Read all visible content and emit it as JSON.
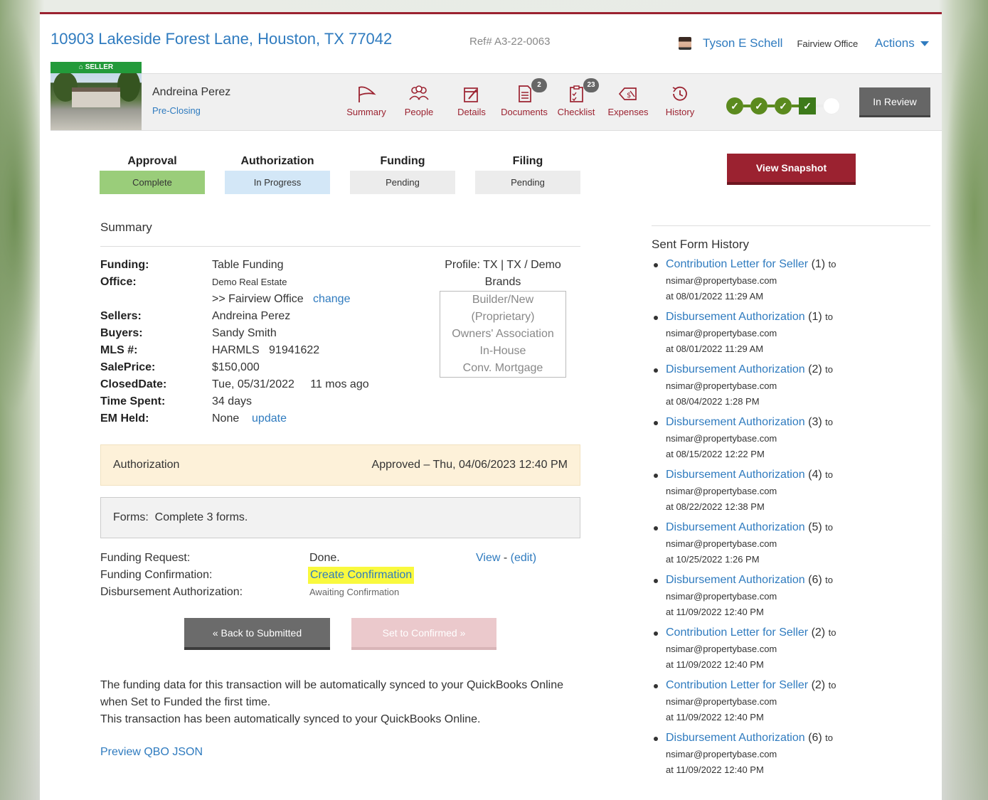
{
  "header": {
    "address": "10903 Lakeside Forest Lane, Houston, TX 77042",
    "ref": "Ref# A3-22-0063",
    "agent_name": "Tyson E Schell",
    "office": "Fairview Office",
    "actions_label": "Actions"
  },
  "listing": {
    "badge": "SELLER",
    "client_name": "Andreina Perez",
    "stage": "Pre-Closing"
  },
  "nav": [
    {
      "label": "Summary",
      "icon": "flag-icon"
    },
    {
      "label": "People",
      "icon": "people-icon"
    },
    {
      "label": "Details",
      "icon": "edit-icon"
    },
    {
      "label": "Documents",
      "icon": "documents-icon",
      "count": "2"
    },
    {
      "label": "Checklist",
      "icon": "checklist-icon",
      "count": "23"
    },
    {
      "label": "Expenses",
      "icon": "expenses-icon"
    },
    {
      "label": "History",
      "icon": "history-icon"
    }
  ],
  "progress": {
    "completed": 4,
    "total": 5
  },
  "status_button": "In Review",
  "steps": [
    {
      "title": "Approval",
      "status": "Complete",
      "color": "#9acd7a"
    },
    {
      "title": "Authorization",
      "status": "In Progress",
      "color": "#d3e7f7"
    },
    {
      "title": "Funding",
      "status": "Pending",
      "color": "#ececec"
    },
    {
      "title": "Filing",
      "status": "Pending",
      "color": "#ececec"
    }
  ],
  "snapshot_button": "View Snapshot",
  "summary": {
    "heading": "Summary",
    "funding_k": "Funding:",
    "funding_v": "Table Funding",
    "office_k": "Office:",
    "office_v": "Demo Real Estate",
    "office_sub": ">> Fairview Office",
    "office_change": "change",
    "sellers_k": "Sellers:",
    "sellers_v": "Andreina Perez",
    "buyers_k": "Buyers:",
    "buyers_v": "Sandy Smith",
    "mls_k": "MLS #:",
    "mls_v": "HARMLS   91941622",
    "price_k": "SalePrice:",
    "price_v": "$150,000",
    "closed_k": "ClosedDate:",
    "closed_v": "Tue, 05/31/2022",
    "closed_ago": "11 mos ago",
    "time_k": "Time Spent:",
    "time_v": "34 days",
    "em_k": "EM Held:",
    "em_v": "None",
    "em_update": "update",
    "profile_line1": "Profile: TX | TX / Demo",
    "profile_line2": "Brands",
    "profile_items": [
      "Builder/New",
      "(Proprietary)",
      "Owners' Association",
      "In-House",
      "Conv. Mortgage"
    ]
  },
  "authorization": {
    "label": "Authorization",
    "status": "Approved – Thu, 04/06/2023 12:40 PM"
  },
  "forms": {
    "text": "Forms:  Complete 3 forms."
  },
  "form_rows": {
    "r1_label": "Funding Request:",
    "r1_status": "Done.",
    "r1_view": "View",
    "r1_sep": "-",
    "r1_edit": "(edit)",
    "r2_label": "Funding Confirmation:",
    "r2_action": "Create Confirmation",
    "r3_label": "Disbursement Authorization:",
    "r3_status": "Awaiting Confirmation"
  },
  "buttons": {
    "back": "« Back to Submitted",
    "confirm": "Set to Confirmed »"
  },
  "sync": {
    "line1": "The funding data for this transaction will be automatically synced to your QuickBooks Online when Set to Funded the first time.",
    "line2": "This transaction has been automatically synced to your QuickBooks Online.",
    "preview": "Preview QBO JSON"
  },
  "history": {
    "heading": "Sent Form History",
    "items": [
      {
        "form": "Contribution Letter for Seller",
        "n": "(1)",
        "to": "to",
        "email": "nsimar@propertybase.com",
        "at": "at 08/01/2022 11:29 AM"
      },
      {
        "form": "Disbursement Authorization",
        "n": "(1)",
        "to": "to",
        "email": "nsimar@propertybase.com",
        "at": "at 08/01/2022 11:29 AM"
      },
      {
        "form": "Disbursement Authorization",
        "n": "(2)",
        "to": "to",
        "email": "nsimar@propertybase.com",
        "at": "at 08/04/2022 1:28 PM"
      },
      {
        "form": "Disbursement Authorization",
        "n": "(3)",
        "to": "to",
        "email": "nsimar@propertybase.com",
        "at": "at 08/15/2022 12:22 PM"
      },
      {
        "form": "Disbursement Authorization",
        "n": "(4)",
        "to": "to",
        "email": "nsimar@propertybase.com",
        "at": "at 08/22/2022 12:38 PM"
      },
      {
        "form": "Disbursement Authorization",
        "n": "(5)",
        "to": "to",
        "email": "nsimar@propertybase.com",
        "at": "at 10/25/2022 1:26 PM"
      },
      {
        "form": "Disbursement Authorization",
        "n": "(6)",
        "to": "to",
        "email": "nsimar@propertybase.com",
        "at": "at 11/09/2022 12:40 PM"
      },
      {
        "form": "Contribution Letter for Seller",
        "n": "(2)",
        "to": "to",
        "email": "nsimar@propertybase.com",
        "at": "at 11/09/2022 12:40 PM"
      },
      {
        "form": "Contribution Letter for Seller",
        "n": "(2)",
        "to": "to",
        "email": "nsimar@propertybase.com",
        "at": "at 11/09/2022 12:40 PM"
      },
      {
        "form": "Disbursement Authorization",
        "n": "(6)",
        "to": "to",
        "email": "nsimar@propertybase.com",
        "at": "at 11/09/2022 12:40 PM"
      }
    ]
  },
  "colors": {
    "brand": "#9b2230",
    "link": "#2f7bbf",
    "progress": "#5b8a1e"
  }
}
